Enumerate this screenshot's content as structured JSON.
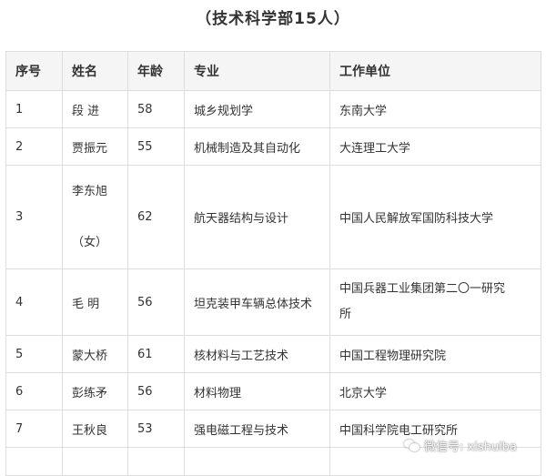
{
  "title": "（技术科学部15人）",
  "table": {
    "headers": [
      "序号",
      "姓名",
      "年龄",
      "专业",
      "工作单位"
    ],
    "rows": [
      [
        "1",
        "段 进",
        "58",
        "城乡规划学",
        "东南大学"
      ],
      [
        "2",
        "贾振元",
        "55",
        "机械制造及其自动化",
        "大连理工大学"
      ],
      [
        "3",
        "李东旭（女）",
        "62",
        "航天器结构与设计",
        "中国人民解放军国防科技大学"
      ],
      [
        "4",
        "毛 明",
        "56",
        "坦克装甲车辆总体技术",
        "中国兵器工业集团第二〇一研究所"
      ],
      [
        "5",
        "蒙大桥",
        "61",
        "核材料与工艺技术",
        "中国工程物理研究院"
      ],
      [
        "6",
        "彭练矛",
        "56",
        "材料物理",
        "北京大学"
      ],
      [
        "7",
        "王秋良",
        "53",
        "强电磁工程与技术",
        "中国科学院电工研究所"
      ]
    ]
  },
  "row3_name_lines": [
    "李东旭",
    "（女）"
  ],
  "row4_org_lines": [
    "中国兵器工业集团第二〇一研究",
    "所"
  ],
  "watermark": {
    "icon": "wechat-icon",
    "text": "微信号: xishuiba"
  }
}
